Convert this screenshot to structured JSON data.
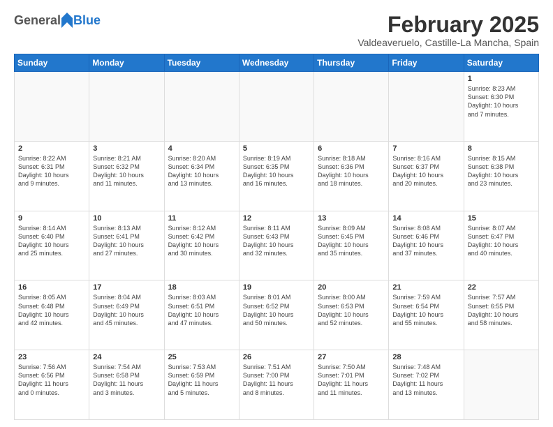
{
  "header": {
    "logo_general": "General",
    "logo_blue": "Blue",
    "month_title": "February 2025",
    "location": "Valdeaveruelo, Castille-La Mancha, Spain"
  },
  "weekdays": [
    "Sunday",
    "Monday",
    "Tuesday",
    "Wednesday",
    "Thursday",
    "Friday",
    "Saturday"
  ],
  "weeks": [
    [
      {
        "day": "",
        "text": ""
      },
      {
        "day": "",
        "text": ""
      },
      {
        "day": "",
        "text": ""
      },
      {
        "day": "",
        "text": ""
      },
      {
        "day": "",
        "text": ""
      },
      {
        "day": "",
        "text": ""
      },
      {
        "day": "1",
        "text": "Sunrise: 8:23 AM\nSunset: 6:30 PM\nDaylight: 10 hours\nand 7 minutes."
      }
    ],
    [
      {
        "day": "2",
        "text": "Sunrise: 8:22 AM\nSunset: 6:31 PM\nDaylight: 10 hours\nand 9 minutes."
      },
      {
        "day": "3",
        "text": "Sunrise: 8:21 AM\nSunset: 6:32 PM\nDaylight: 10 hours\nand 11 minutes."
      },
      {
        "day": "4",
        "text": "Sunrise: 8:20 AM\nSunset: 6:34 PM\nDaylight: 10 hours\nand 13 minutes."
      },
      {
        "day": "5",
        "text": "Sunrise: 8:19 AM\nSunset: 6:35 PM\nDaylight: 10 hours\nand 16 minutes."
      },
      {
        "day": "6",
        "text": "Sunrise: 8:18 AM\nSunset: 6:36 PM\nDaylight: 10 hours\nand 18 minutes."
      },
      {
        "day": "7",
        "text": "Sunrise: 8:16 AM\nSunset: 6:37 PM\nDaylight: 10 hours\nand 20 minutes."
      },
      {
        "day": "8",
        "text": "Sunrise: 8:15 AM\nSunset: 6:38 PM\nDaylight: 10 hours\nand 23 minutes."
      }
    ],
    [
      {
        "day": "9",
        "text": "Sunrise: 8:14 AM\nSunset: 6:40 PM\nDaylight: 10 hours\nand 25 minutes."
      },
      {
        "day": "10",
        "text": "Sunrise: 8:13 AM\nSunset: 6:41 PM\nDaylight: 10 hours\nand 27 minutes."
      },
      {
        "day": "11",
        "text": "Sunrise: 8:12 AM\nSunset: 6:42 PM\nDaylight: 10 hours\nand 30 minutes."
      },
      {
        "day": "12",
        "text": "Sunrise: 8:11 AM\nSunset: 6:43 PM\nDaylight: 10 hours\nand 32 minutes."
      },
      {
        "day": "13",
        "text": "Sunrise: 8:09 AM\nSunset: 6:45 PM\nDaylight: 10 hours\nand 35 minutes."
      },
      {
        "day": "14",
        "text": "Sunrise: 8:08 AM\nSunset: 6:46 PM\nDaylight: 10 hours\nand 37 minutes."
      },
      {
        "day": "15",
        "text": "Sunrise: 8:07 AM\nSunset: 6:47 PM\nDaylight: 10 hours\nand 40 minutes."
      }
    ],
    [
      {
        "day": "16",
        "text": "Sunrise: 8:05 AM\nSunset: 6:48 PM\nDaylight: 10 hours\nand 42 minutes."
      },
      {
        "day": "17",
        "text": "Sunrise: 8:04 AM\nSunset: 6:49 PM\nDaylight: 10 hours\nand 45 minutes."
      },
      {
        "day": "18",
        "text": "Sunrise: 8:03 AM\nSunset: 6:51 PM\nDaylight: 10 hours\nand 47 minutes."
      },
      {
        "day": "19",
        "text": "Sunrise: 8:01 AM\nSunset: 6:52 PM\nDaylight: 10 hours\nand 50 minutes."
      },
      {
        "day": "20",
        "text": "Sunrise: 8:00 AM\nSunset: 6:53 PM\nDaylight: 10 hours\nand 52 minutes."
      },
      {
        "day": "21",
        "text": "Sunrise: 7:59 AM\nSunset: 6:54 PM\nDaylight: 10 hours\nand 55 minutes."
      },
      {
        "day": "22",
        "text": "Sunrise: 7:57 AM\nSunset: 6:55 PM\nDaylight: 10 hours\nand 58 minutes."
      }
    ],
    [
      {
        "day": "23",
        "text": "Sunrise: 7:56 AM\nSunset: 6:56 PM\nDaylight: 11 hours\nand 0 minutes."
      },
      {
        "day": "24",
        "text": "Sunrise: 7:54 AM\nSunset: 6:58 PM\nDaylight: 11 hours\nand 3 minutes."
      },
      {
        "day": "25",
        "text": "Sunrise: 7:53 AM\nSunset: 6:59 PM\nDaylight: 11 hours\nand 5 minutes."
      },
      {
        "day": "26",
        "text": "Sunrise: 7:51 AM\nSunset: 7:00 PM\nDaylight: 11 hours\nand 8 minutes."
      },
      {
        "day": "27",
        "text": "Sunrise: 7:50 AM\nSunset: 7:01 PM\nDaylight: 11 hours\nand 11 minutes."
      },
      {
        "day": "28",
        "text": "Sunrise: 7:48 AM\nSunset: 7:02 PM\nDaylight: 11 hours\nand 13 minutes."
      },
      {
        "day": "",
        "text": ""
      }
    ]
  ]
}
